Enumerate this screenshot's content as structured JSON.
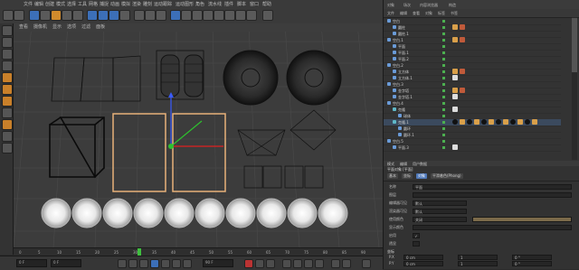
{
  "toolbar": {
    "menus": [
      "文件",
      "编辑",
      "创建",
      "模式",
      "选择",
      "工具",
      "网格",
      "捕捉",
      "动画",
      "模拟",
      "渲染",
      "雕刻",
      "运动跟踪",
      "运动图形",
      "角色",
      "流水线",
      "插件",
      "脚本",
      "窗口",
      "帮助"
    ]
  },
  "viewport": {
    "menu": [
      "查看",
      "摄像机",
      "显示",
      "选项",
      "过滤",
      "面板"
    ]
  },
  "object_manager": {
    "tabs": [
      "对象",
      "场次",
      "内容浏览器",
      "构造"
    ],
    "menu": [
      "文件",
      "编辑",
      "查看",
      "对象",
      "标签",
      "书签"
    ],
    "rows": [
      {
        "label": "空白",
        "indent": 0
      },
      {
        "label": "圆柱",
        "indent": 1
      },
      {
        "label": "圆柱.1",
        "indent": 1
      },
      {
        "label": "空白.1",
        "indent": 0
      },
      {
        "label": "平面",
        "indent": 1
      },
      {
        "label": "平面.1",
        "indent": 1
      },
      {
        "label": "平面.2",
        "indent": 1
      },
      {
        "label": "空白.2",
        "indent": 0
      },
      {
        "label": "立方体",
        "indent": 1
      },
      {
        "label": "立方体.1",
        "indent": 1
      },
      {
        "label": "空白.3",
        "indent": 0
      },
      {
        "label": "金字塔",
        "indent": 1
      },
      {
        "label": "金字塔.1",
        "indent": 1
      },
      {
        "label": "空白.4",
        "indent": 0
      },
      {
        "label": "克隆",
        "indent": 1
      },
      {
        "label": "球体",
        "indent": 2
      },
      {
        "label": "克隆.1",
        "indent": 1
      },
      {
        "label": "圆环",
        "indent": 2
      },
      {
        "label": "圆环.1",
        "indent": 2
      },
      {
        "label": "空白.5",
        "indent": 0
      },
      {
        "label": "平面.3",
        "indent": 1
      }
    ]
  },
  "attribute_manager": {
    "menu": [
      "模式",
      "编辑",
      "用户数据"
    ],
    "title": "平面对象 [平面]",
    "tabs": [
      "基本",
      "坐标",
      "对象",
      "平滑着色(Phong)"
    ],
    "rows": [
      {
        "label": "名称",
        "value": "平面"
      },
      {
        "label": "图层",
        "value": ""
      },
      {
        "label": "编辑器可见",
        "value": "默认"
      },
      {
        "label": "渲染器可见",
        "value": "默认"
      },
      {
        "label": "使用颜色",
        "value": "关闭"
      },
      {
        "label": "显示颜色",
        "value": ""
      },
      {
        "label": "启用",
        "value": "✓"
      },
      {
        "label": "透显",
        "value": ""
      }
    ],
    "coords_header": "坐标",
    "coords": [
      {
        "axis": "P.X",
        "val": "0 cm",
        "s": "1",
        "r": "0 °"
      },
      {
        "axis": "P.Y",
        "val": "0 cm",
        "s": "1",
        "r": "0 °"
      },
      {
        "axis": "P.Z",
        "val": "0 cm",
        "s": "1",
        "r": "0 °"
      }
    ]
  },
  "timeline": {
    "ticks": [
      "0",
      "5",
      "10",
      "15",
      "20",
      "25",
      "30",
      "35",
      "40",
      "45",
      "50",
      "55",
      "60",
      "65",
      "70",
      "75",
      "80",
      "85",
      "90"
    ],
    "current": "0 F",
    "start": "0 F",
    "end": "90 F"
  }
}
